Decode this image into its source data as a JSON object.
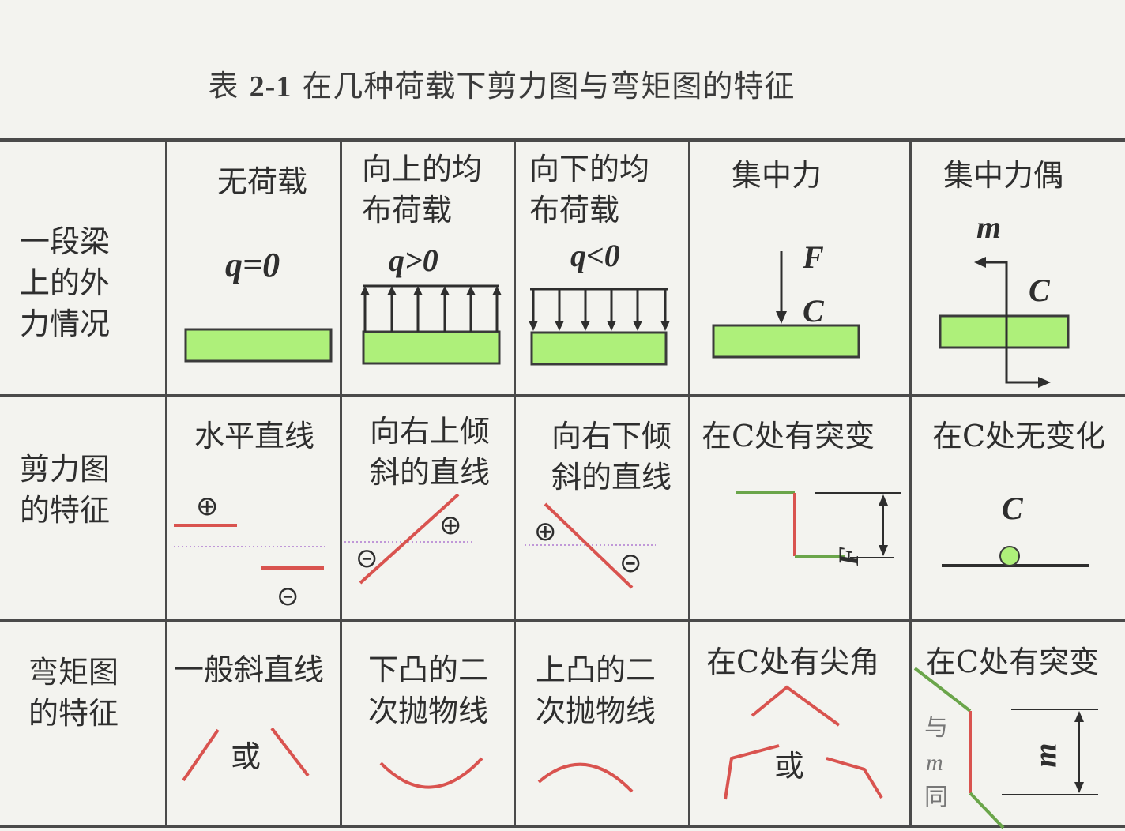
{
  "title": {
    "prefix": "表",
    "number": "2-1",
    "text": "在几种荷载下剪力图与弯矩图的特征"
  },
  "row_headers": {
    "load": "一段梁\n上的外\n力情况",
    "shear": "剪力图\n的特征",
    "moment": "弯矩图\n的特征"
  },
  "columns": [
    {
      "title": "无荷载",
      "q": "q=0"
    },
    {
      "title": "向上的均\n布荷载",
      "q": "q>0"
    },
    {
      "title": "向下的均\n布荷载",
      "q": "q<0"
    },
    {
      "title": "集中力",
      "force": "F",
      "point": "C"
    },
    {
      "title": "集中力偶",
      "moment": "m",
      "point": "C"
    }
  ],
  "shear_features": [
    "水平直线",
    "向右上倾\n斜的直线",
    "向右下倾\n斜的直线",
    "在C处有突变",
    "在C处无变化"
  ],
  "shear_labels": {
    "point": "C",
    "force": "F",
    "plus": "⊕",
    "minus": "⊝"
  },
  "moment_features": [
    "一般斜直线",
    "下凸的二\n次抛物线",
    "上凸的二\n次抛物线",
    "在C处有尖角",
    "在C处有突变"
  ],
  "moment_labels": {
    "or": "或",
    "same_as": "与",
    "m": "m",
    "same": "同"
  },
  "colors": {
    "beam": "#aef07a",
    "positive": "#d9534f",
    "step": "#6aa54a",
    "grid": "#4a4a4a"
  }
}
